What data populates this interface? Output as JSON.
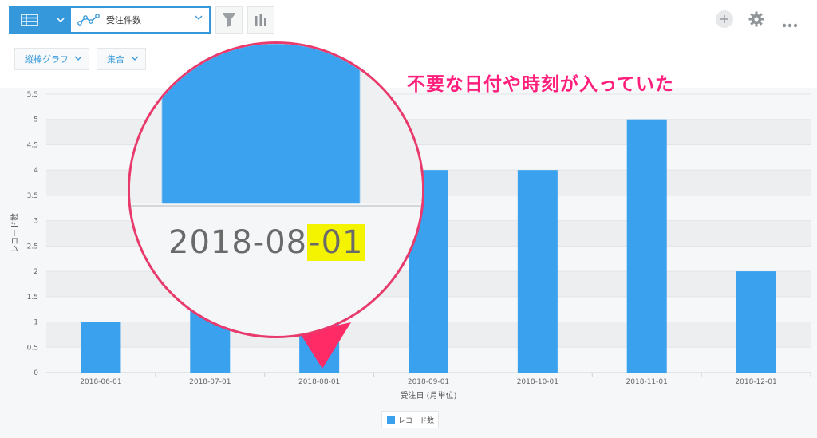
{
  "toolbar": {
    "graph_name": "受注件数",
    "icons": [
      "table-icon",
      "chevron-down-icon",
      "line-graph-icon",
      "filter-icon",
      "bar-settings-icon",
      "plus-icon",
      "gear-icon",
      "more-icon"
    ]
  },
  "controls": {
    "chart_type": "縦棒グラフ",
    "aggregation": "集合"
  },
  "annotation": {
    "text": "不要な日付や時刻が入っていた",
    "color": "#ff1f7c"
  },
  "magnifier": {
    "date_prefix": "2018-08",
    "date_highlight": "-01"
  },
  "chart_data": {
    "type": "bar",
    "categories": [
      "2018-06-01",
      "2018-07-01",
      "2018-08-01",
      "2018-09-01",
      "2018-10-01",
      "2018-11-01",
      "2018-12-01"
    ],
    "series": [
      {
        "name": "レコード数",
        "values": [
          1,
          2,
          2,
          4,
          4,
          5,
          2
        ],
        "color": "#3aa1ee"
      }
    ],
    "xlabel": "受注日 (月単位)",
    "ylabel": "レコード数",
    "ylim": [
      0,
      5.5
    ],
    "yticks": [
      "0",
      "0.5",
      "1",
      "1.5",
      "2",
      "2.5",
      "3",
      "3.5",
      "4",
      "4.5",
      "5",
      "5.5"
    ],
    "legend_position": "bottom"
  }
}
